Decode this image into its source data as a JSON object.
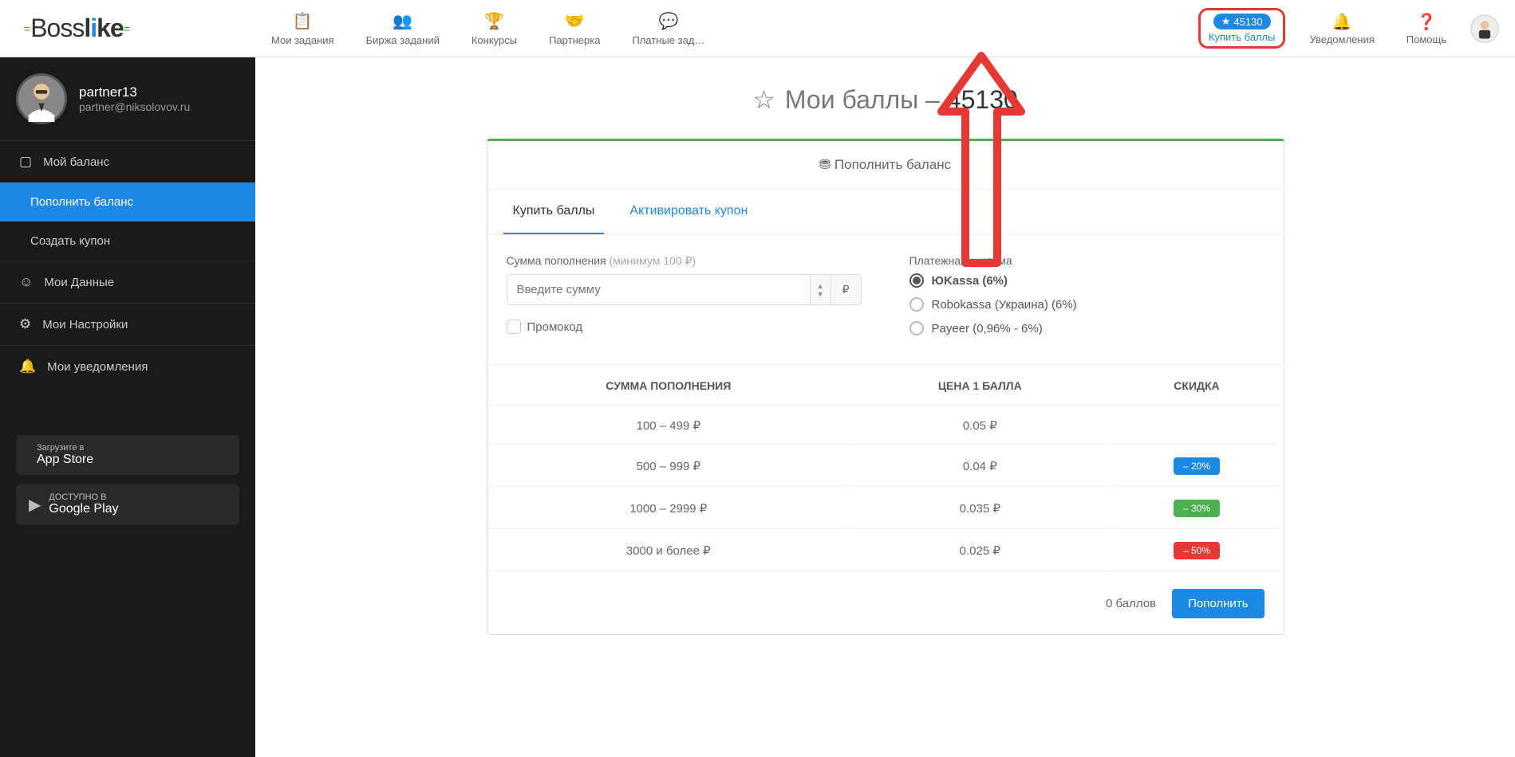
{
  "logo": {
    "part1": "Boss",
    "part2": "l",
    "part3": "i",
    "part4": "ke"
  },
  "nav": {
    "my_tasks": "Мои задания",
    "task_exchange": "Биржа заданий",
    "contests": "Конкурсы",
    "affiliate": "Партнерка",
    "paid_tasks": "Платные зад…"
  },
  "header": {
    "points": "45130",
    "buy_points": "Купить баллы",
    "notifications": "Уведомления",
    "help": "Помощь"
  },
  "profile": {
    "name": "partner13",
    "email": "partner@niksolovov.ru"
  },
  "sidebar": {
    "balance": "Мой баланс",
    "topup": "Пополнить баланс",
    "create_coupon": "Создать купон",
    "my_data": "Мои Данные",
    "my_settings": "Мои Настройки",
    "my_notifications": "Мои уведомления",
    "appstore_hint": "Загрузите в",
    "appstore": "App Store",
    "gplay_hint": "ДОСТУПНО В",
    "gplay": "Google Play"
  },
  "main": {
    "title_prefix": "Мои баллы –",
    "title_value": "45130",
    "card_header": "Пополнить баланс",
    "tab_buy": "Купить баллы",
    "tab_coupon": "Активировать купон",
    "amount_label": "Сумма пополнения",
    "amount_hint": "(минимум 100 ₽)",
    "amount_placeholder": "Введите сумму",
    "currency": "₽",
    "promo": "Промокод",
    "payment_system": "Платежная система",
    "payment_options": {
      "yukassa": "ЮKassa (6%)",
      "robokassa": "Robokassa (Украина) (6%)",
      "payeer": "Payeer (0,96% - 6%)"
    },
    "table": {
      "col_amount": "СУММА ПОПОЛНЕНИЯ",
      "col_price": "ЦЕНА 1 БАЛЛА",
      "col_discount": "СКИДКА",
      "rows": [
        {
          "amount": "100 – 499 ₽",
          "price": "0.05 ₽",
          "discount": ""
        },
        {
          "amount": "500 – 999 ₽",
          "price": "0.04 ₽",
          "discount": "– 20%"
        },
        {
          "amount": "1000 – 2999 ₽",
          "price": "0.035 ₽",
          "discount": "– 30%"
        },
        {
          "amount": "3000 и более ₽",
          "price": "0.025 ₽",
          "discount": "– 50%"
        }
      ]
    },
    "footer_points": "0 баллов",
    "footer_button": "Пополнить"
  }
}
